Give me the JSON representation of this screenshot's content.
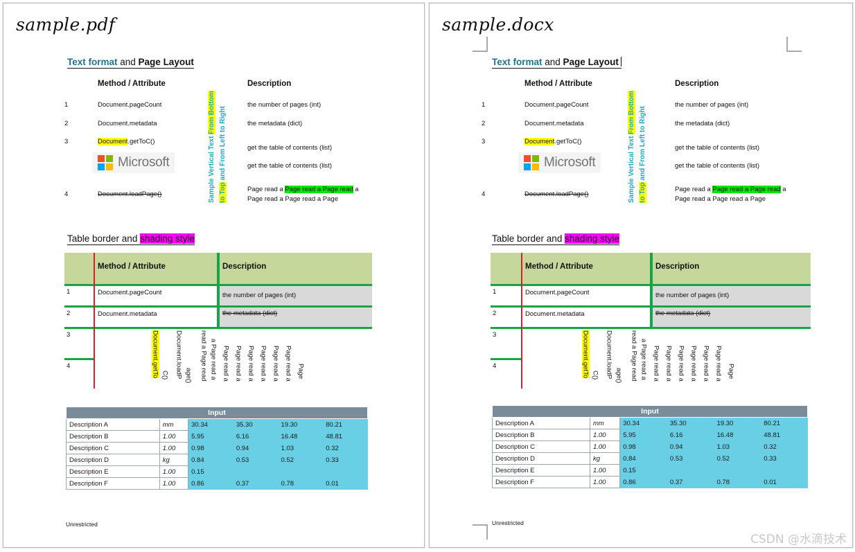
{
  "panels": [
    {
      "id": "pdf",
      "file_title": "sample.pdf",
      "show_corner_marks": false,
      "show_caret": false
    },
    {
      "id": "docx",
      "file_title": "sample.docx",
      "show_corner_marks": true,
      "show_caret": true
    }
  ],
  "headings": {
    "text_format_blue": "Text format",
    "text_format_and": " and ",
    "text_format_bold": "Page Layout",
    "table_border_plain": "Table border and ",
    "table_border_magenta": "shading style"
  },
  "list_section": {
    "col_method": "Method / Attribute",
    "col_description": "Description",
    "rows": [
      {
        "index": "1",
        "method_pre": "",
        "method_hl": "",
        "method_post": "Document.pageCount",
        "struck": false,
        "description": "the number of pages (int)"
      },
      {
        "index": "2",
        "method_pre": "",
        "method_hl": "",
        "method_post": "Document.metadata",
        "struck": false,
        "description": "the metadata (dict)"
      },
      {
        "index": "3",
        "method_pre": "",
        "method_hl": "Document",
        "method_post": ".getToC()",
        "struck": false,
        "description": "get the table of contents (list)"
      },
      {
        "index": "",
        "method_pre": "",
        "method_hl": "",
        "method_post": "",
        "struck": false,
        "description": "get the table of contents (list)"
      },
      {
        "index": "4",
        "method_pre": "",
        "method_hl": "",
        "method_post": "Document.loadPage()",
        "struck": true,
        "description": ""
      }
    ],
    "page_read_line1_pre": "Page read a ",
    "page_read_line1_hl": "Page read a Page read",
    "page_read_line1_post": " a",
    "page_read_line2": "Page read a Page read a Page",
    "vertical_text_col1_a": "Sample Vertical Text ",
    "vertical_text_col1_b": "From Bottom",
    "vertical_text_col2_a": "to Top",
    "vertical_text_col2_b": " and From Left to Right",
    "microsoft_word": "Microsoft",
    "microsoft_colors": {
      "top_left": "#f25022",
      "top_right": "#7fba00",
      "bottom_left": "#00a4ef",
      "bottom_right": "#ffb900"
    }
  },
  "green_table": {
    "col_method": "Method / Attribute",
    "col_description": "Description",
    "rows": [
      {
        "index": "1",
        "method": "Document.pageCount",
        "description": "the number of pages (int)",
        "desc_struck": false
      },
      {
        "index": "2",
        "method": "Document.metadata",
        "description": "the metadata (dict)",
        "desc_struck": true
      },
      {
        "index": "3",
        "method": "",
        "description": "",
        "desc_struck": false
      },
      {
        "index": "4",
        "method": "",
        "description": "",
        "desc_struck": false
      }
    ],
    "vertical_cells": [
      {
        "pre": "",
        "hl": "Document.getTo",
        "post": "",
        "struck": false,
        "line2": "C()"
      },
      {
        "pre": "",
        "hl": "",
        "post": "Document.loadP",
        "struck": true,
        "line2": "age()"
      },
      {
        "pre": "",
        "hl": "",
        "post": "read a Page read",
        "struck": false,
        "line2": "a Page read a"
      },
      {
        "pre": "",
        "hl": "",
        "post": "Page read a",
        "struck": false,
        "line2": ""
      },
      {
        "pre": "",
        "hl": "",
        "post": "Page read a",
        "struck": false,
        "line2": ""
      },
      {
        "pre": "",
        "hl": "",
        "post": "Page read a",
        "struck": false,
        "line2": ""
      },
      {
        "pre": "",
        "hl": "",
        "post": "Page read a",
        "struck": false,
        "line2": ""
      },
      {
        "pre": "",
        "hl": "",
        "post": "Page read a",
        "struck": false,
        "line2": ""
      },
      {
        "pre": "",
        "hl": "",
        "post": "Page read a",
        "struck": false,
        "line2": ""
      },
      {
        "pre": "",
        "hl": "",
        "post": "Page",
        "struck": false,
        "line2": ""
      }
    ],
    "colors": {
      "header_fill": "#c5d79a",
      "border_green": "#16a34a",
      "border_red": "#e01b24",
      "shade_gray": "#d9d9d9"
    }
  },
  "blue_table": {
    "header": "Input",
    "rows": [
      {
        "label": "Description A",
        "unit": "mm",
        "values": [
          "30.34",
          "35.30",
          "19.30",
          "80.21"
        ]
      },
      {
        "label": "Description B",
        "unit": "1.00",
        "values": [
          "5.95",
          "6.16",
          "16.48",
          "48.81"
        ]
      },
      {
        "label": "Description C",
        "unit": "1.00",
        "values": [
          "0.98",
          "0.94",
          "1.03",
          "0.32"
        ]
      },
      {
        "label": "Description D",
        "unit": "kg",
        "values": [
          "0.84",
          "0.53",
          "0.52",
          "0.33"
        ]
      },
      {
        "label": "Description E",
        "unit": "1.00",
        "values": [
          "0.15",
          "",
          "",
          ""
        ]
      },
      {
        "label": "Description F",
        "unit": "1.00",
        "values": [
          "0.86",
          "0.37",
          "0.78",
          "0.01"
        ]
      }
    ],
    "colors": {
      "header_fill": "#7a8b99",
      "value_fill": "#68cfe4"
    }
  },
  "footer": {
    "classification": "Unrestricted"
  },
  "watermark": {
    "text": "CSDN @水滴技术"
  }
}
